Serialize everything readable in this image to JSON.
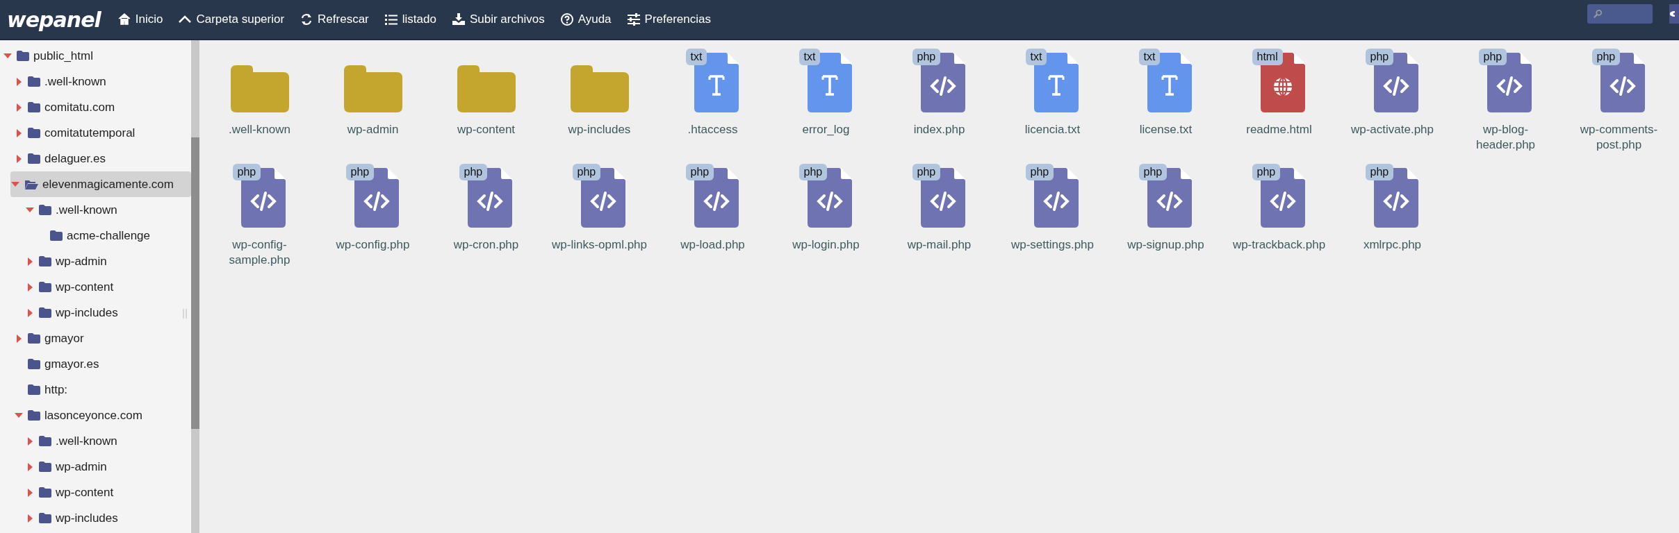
{
  "app": {
    "logo": "wepanel"
  },
  "toolbar": [
    {
      "label": "Inicio",
      "kind": "home"
    },
    {
      "label": "Carpeta superior",
      "kind": "up"
    },
    {
      "label": "Refrescar",
      "kind": "refresh"
    },
    {
      "label": "listado",
      "kind": "list"
    },
    {
      "label": "Subir archivos",
      "kind": "upload"
    },
    {
      "label": "Ayuda",
      "kind": "help"
    },
    {
      "label": "Preferencias",
      "kind": "prefs"
    }
  ],
  "tree": [
    {
      "label": "public_html",
      "kind": "branch",
      "expanded": true,
      "selected": false,
      "children": [
        {
          "label": ".well-known",
          "kind": "branch",
          "expanded": false,
          "selected": false
        },
        {
          "label": "comitatu.com",
          "kind": "branch",
          "expanded": false,
          "selected": false
        },
        {
          "label": "comitatutemporal",
          "kind": "branch",
          "expanded": false,
          "selected": false
        },
        {
          "label": "delaguer.es",
          "kind": "branch",
          "expanded": false,
          "selected": false
        },
        {
          "label": "elevenmagicamente.com",
          "kind": "branch",
          "expanded": true,
          "selected": true,
          "children": [
            {
              "label": ".well-known",
              "kind": "branch",
              "expanded": true,
              "selected": false,
              "children": [
                {
                  "label": "acme-challenge",
                  "kind": "leaf",
                  "selected": false
                }
              ]
            },
            {
              "label": "wp-admin",
              "kind": "branch",
              "expanded": false,
              "selected": false
            },
            {
              "label": "wp-content",
              "kind": "branch",
              "expanded": false,
              "selected": false
            },
            {
              "label": "wp-includes",
              "kind": "branch",
              "expanded": false,
              "selected": false
            }
          ]
        },
        {
          "label": "gmayor",
          "kind": "branch",
          "expanded": false,
          "selected": false
        },
        {
          "label": "gmayor.es",
          "kind": "leaf",
          "selected": false
        },
        {
          "label": "http:",
          "kind": "leaf",
          "selected": false
        },
        {
          "label": "lasonceyonce.com",
          "kind": "branch",
          "expanded": true,
          "selected": false,
          "children": [
            {
              "label": ".well-known",
              "kind": "branch",
              "expanded": false,
              "selected": false
            },
            {
              "label": "wp-admin",
              "kind": "branch",
              "expanded": false,
              "selected": false
            },
            {
              "label": "wp-content",
              "kind": "branch",
              "expanded": false,
              "selected": false
            },
            {
              "label": "wp-includes",
              "kind": "branch",
              "expanded": false,
              "selected": false
            }
          ]
        }
      ]
    }
  ],
  "files": [
    {
      "name": ".well-known",
      "kind": "folder"
    },
    {
      "name": "wp-admin",
      "kind": "folder"
    },
    {
      "name": "wp-content",
      "kind": "folder"
    },
    {
      "name": "wp-includes",
      "kind": "folder"
    },
    {
      "name": ".htaccess",
      "kind": "txt",
      "badge": "txt"
    },
    {
      "name": "error_log",
      "kind": "txt",
      "badge": "txt"
    },
    {
      "name": "index.php",
      "kind": "php",
      "badge": "php"
    },
    {
      "name": "licencia.txt",
      "kind": "txt",
      "badge": "txt"
    },
    {
      "name": "license.txt",
      "kind": "txt",
      "badge": "txt"
    },
    {
      "name": "readme.html",
      "kind": "html",
      "badge": "html"
    },
    {
      "name": "wp-activate.php",
      "kind": "php",
      "badge": "php"
    },
    {
      "name": "wp-blog-header.php",
      "kind": "php",
      "badge": "php"
    },
    {
      "name": "wp-comments-post.php",
      "kind": "php",
      "badge": "php"
    },
    {
      "name": "wp-config-sample.php",
      "kind": "php",
      "badge": "php"
    },
    {
      "name": "wp-config.php",
      "kind": "php",
      "badge": "php"
    },
    {
      "name": "wp-cron.php",
      "kind": "php",
      "badge": "php"
    },
    {
      "name": "wp-links-opml.php",
      "kind": "php",
      "badge": "php"
    },
    {
      "name": "wp-load.php",
      "kind": "php",
      "badge": "php"
    },
    {
      "name": "wp-login.php",
      "kind": "php",
      "badge": "php"
    },
    {
      "name": "wp-mail.php",
      "kind": "php",
      "badge": "php"
    },
    {
      "name": "wp-settings.php",
      "kind": "php",
      "badge": "php"
    },
    {
      "name": "wp-signup.php",
      "kind": "php",
      "badge": "php"
    },
    {
      "name": "wp-trackback.php",
      "kind": "php",
      "badge": "php"
    },
    {
      "name": "xmlrpc.php",
      "kind": "php",
      "badge": "php"
    }
  ]
}
